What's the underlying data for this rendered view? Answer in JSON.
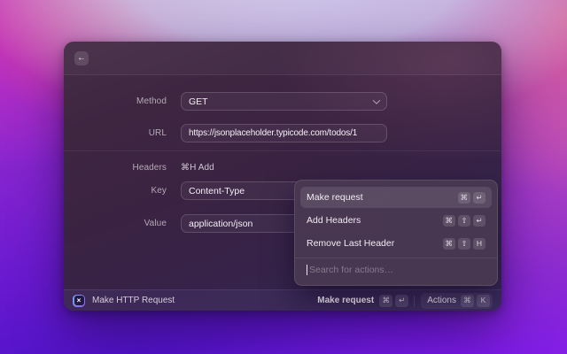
{
  "icons": {
    "back": "←",
    "extension": "×"
  },
  "form": {
    "method": {
      "label": "Method",
      "value": "GET"
    },
    "url": {
      "label": "URL",
      "value": "https://jsonplaceholder.typicode.com/todos/1"
    },
    "headers": {
      "label": "Headers",
      "add_hint": "⌘H Add"
    },
    "key": {
      "label": "Key",
      "value": "Content-Type"
    },
    "value": {
      "label": "Value",
      "value": "application/json"
    }
  },
  "actions_panel": {
    "items": [
      {
        "label": "Make request",
        "keys": [
          "⌘",
          "↵"
        ],
        "selected": true
      },
      {
        "label": "Add Headers",
        "keys": [
          "⌘",
          "⇧",
          "↵"
        ],
        "selected": false
      },
      {
        "label": "Remove Last Header",
        "keys": [
          "⌘",
          "⇧",
          "H"
        ],
        "selected": false
      }
    ],
    "search_placeholder": "Search for actions…"
  },
  "status_bar": {
    "app_name": "Make HTTP Request",
    "primary_action": {
      "label": "Make request",
      "keys": [
        "⌘",
        "↵"
      ]
    },
    "actions_button": {
      "label": "Actions",
      "keys": [
        "⌘",
        "K"
      ]
    }
  },
  "colors": {
    "panel_bg": "#493852",
    "selection": "#5d4964",
    "extension_accent": "#7a5ff2",
    "wallpaper_top": "#c8c1e4",
    "wallpaper_bottom": "#4f12c8"
  }
}
